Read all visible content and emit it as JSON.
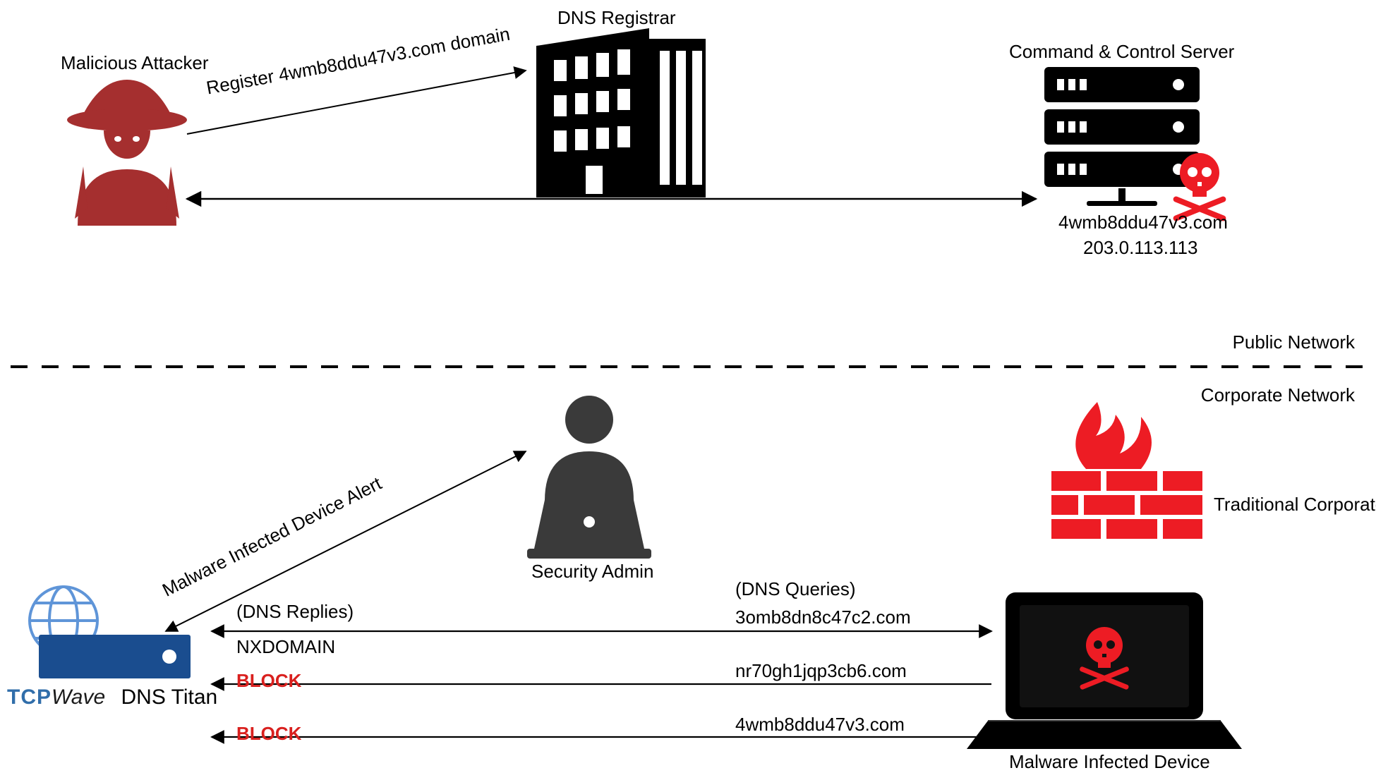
{
  "labels": {
    "attacker": "Malicious Attacker",
    "registrar": "DNS Registrar",
    "c2": "Command & Control Server",
    "c2_domain": "4wmb8ddu47v3.com",
    "c2_ip": "203.0.113.113",
    "public_net": "Public Network",
    "corp_net": "Corporate Network",
    "sec_admin": "Security Admin",
    "firewall": "Traditional Corporate Firewall",
    "infected": "Malware Infected Device",
    "dns_titan": "DNS Titan",
    "brand_tcp": "TCP",
    "brand_wave": "Wave"
  },
  "arrows": {
    "register": "Register 4wmb8ddu47v3.com domain",
    "alert": "Malware Infected Device Alert",
    "dns_replies": "(DNS Replies)",
    "dns_queries": "(DNS Queries)",
    "nxdomain": "NXDOMAIN",
    "block1": "BLOCK",
    "block2": "BLOCK",
    "q1": "3omb8dn8c47c2.com",
    "q2": "nr70gh1jqp3cb6.com",
    "q3": "4wmb8ddu47v3.com"
  },
  "colors": {
    "attacker": "#a52f2f",
    "red": "#ed1c24",
    "dark": "#3a3a3a",
    "titan": "#1a4d8f",
    "globe": "#5f95d8"
  }
}
